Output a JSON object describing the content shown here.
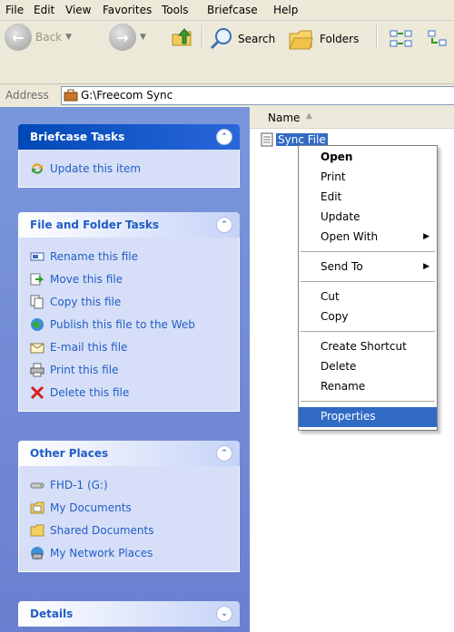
{
  "menubar": {
    "items": [
      "File",
      "Edit",
      "View",
      "Favorites",
      "Tools",
      "Briefcase",
      "Help"
    ]
  },
  "toolbar": {
    "back_label": "Back",
    "search_label": "Search",
    "folders_label": "Folders"
  },
  "address": {
    "label": "Address",
    "value": "G:\\Freecom Sync"
  },
  "task_panes": {
    "briefcase": {
      "title": "Briefcase Tasks",
      "items": [
        "Update this item"
      ]
    },
    "file_folder": {
      "title": "File and Folder Tasks",
      "items": [
        "Rename this file",
        "Move this file",
        "Copy this file",
        "Publish this file to the Web",
        "E-mail this file",
        "Print this file",
        "Delete this file"
      ]
    },
    "other_places": {
      "title": "Other Places",
      "items": [
        "FHD-1 (G:)",
        "My Documents",
        "Shared Documents",
        "My Network Places"
      ]
    },
    "details": {
      "title": "Details"
    }
  },
  "file_list": {
    "column_name": "Name",
    "files": [
      "Sync File"
    ]
  },
  "context_menu": {
    "items": [
      "Open",
      "Print",
      "Edit",
      "Update",
      "Open With",
      "Send To",
      "Cut",
      "Copy",
      "Create Shortcut",
      "Delete",
      "Rename",
      "Properties"
    ],
    "highlighted": "Properties"
  },
  "colors": {
    "selection": "#316ac5",
    "task_link": "#215dc6",
    "pane_bg": "#7b97dc"
  }
}
